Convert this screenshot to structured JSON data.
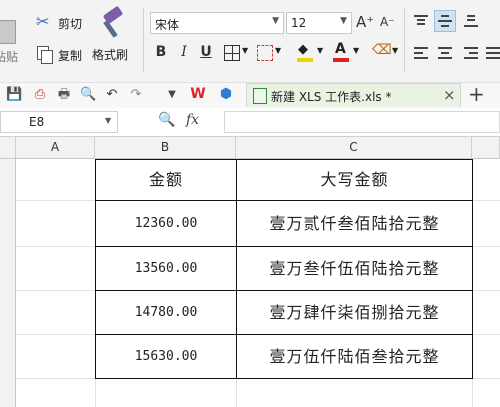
{
  "clipboard": {
    "paste_label": "粘贴",
    "cut_label": "剪切",
    "copy_label": "复制",
    "format_painter_label": "格式刷"
  },
  "font": {
    "name": "宋体",
    "size": "12"
  },
  "format": {
    "bold": "B",
    "italic": "I",
    "underline": "U",
    "grow": "A⁺",
    "shrink": "A⁻"
  },
  "tab": {
    "title": "新建 XLS 工作表.xls *",
    "close": "×",
    "add": "+"
  },
  "formula_bar": {
    "name_box": "E8",
    "fx": "fx",
    "value": ""
  },
  "columns": [
    "A",
    "B",
    "C"
  ],
  "table": {
    "headers": [
      "金额",
      "大写金额"
    ],
    "rows": [
      {
        "amount": "12360.00",
        "uppercase": "壹万贰仟叁佰陆拾元整"
      },
      {
        "amount": "13560.00",
        "uppercase": "壹万叁仟伍佰陆拾元整"
      },
      {
        "amount": "14780.00",
        "uppercase": "壹万肆仟柒佰捌拾元整"
      },
      {
        "amount": "15630.00",
        "uppercase": "壹万伍仟陆佰叁拾元整"
      }
    ]
  },
  "colors": {
    "font_color_bar": "#e02020",
    "fill_color_bar": "#f5d000",
    "tab_bg": "#e8f3e4",
    "wps_red": "#d9262c"
  }
}
